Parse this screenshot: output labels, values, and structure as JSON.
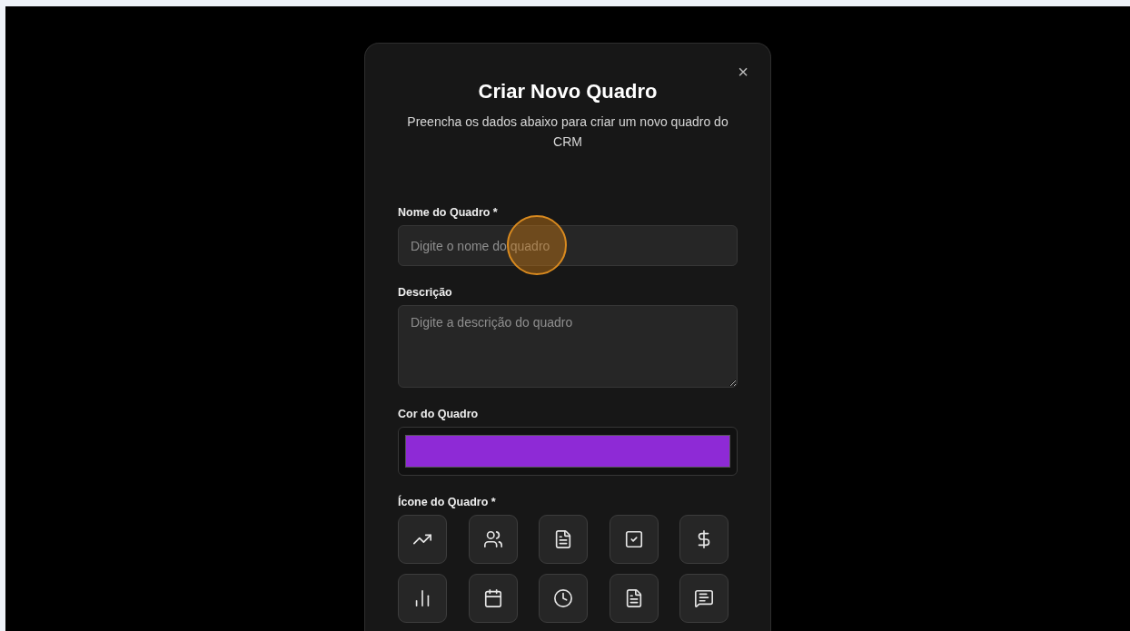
{
  "dialog": {
    "title": "Criar Novo Quadro",
    "description": "Preencha os dados abaixo para criar um novo quadro do CRM",
    "close": "×"
  },
  "fields": [
    {
      "kind": "text",
      "label": "Nome do Quadro *",
      "placeholder": "Digite o nome do quadro"
    },
    {
      "kind": "textarea",
      "label": "Descrição",
      "placeholder": "Digite a descrição do quadro"
    },
    {
      "kind": "color",
      "label": "Cor do Quadro",
      "color": "#8e2ad6"
    }
  ],
  "icon_picker": {
    "label": "Ícone do Quadro *",
    "options": [
      {
        "selected": false
      },
      {
        "selected": false
      },
      {
        "selected": false
      },
      {
        "selected": false
      },
      {
        "selected": false
      },
      {
        "selected": false
      },
      {
        "selected": false
      },
      {
        "selected": false
      },
      {
        "selected": false
      },
      {
        "selected": false
      }
    ]
  }
}
